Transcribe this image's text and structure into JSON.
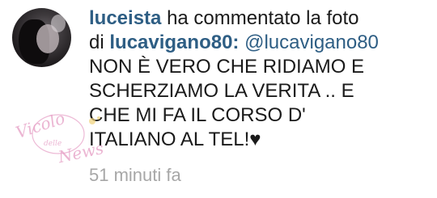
{
  "comment": {
    "username": "luceista",
    "action_line1": "ha commentato la foto",
    "prep": "di",
    "photo_owner": "lucavigano80:",
    "mention": "@lucavigano80",
    "text_lines": [
      "NON È VERO CHE RIDIAMO E",
      "SCHERZIAMO LA VERITA .. E",
      "CHE MI FA IL CORSO D'",
      "ITALIANO AL TEL!♥"
    ],
    "time": "51 minuti fa"
  },
  "watermark": {
    "brand": "Vicolo delle News",
    "color": "#e7a3c8"
  }
}
